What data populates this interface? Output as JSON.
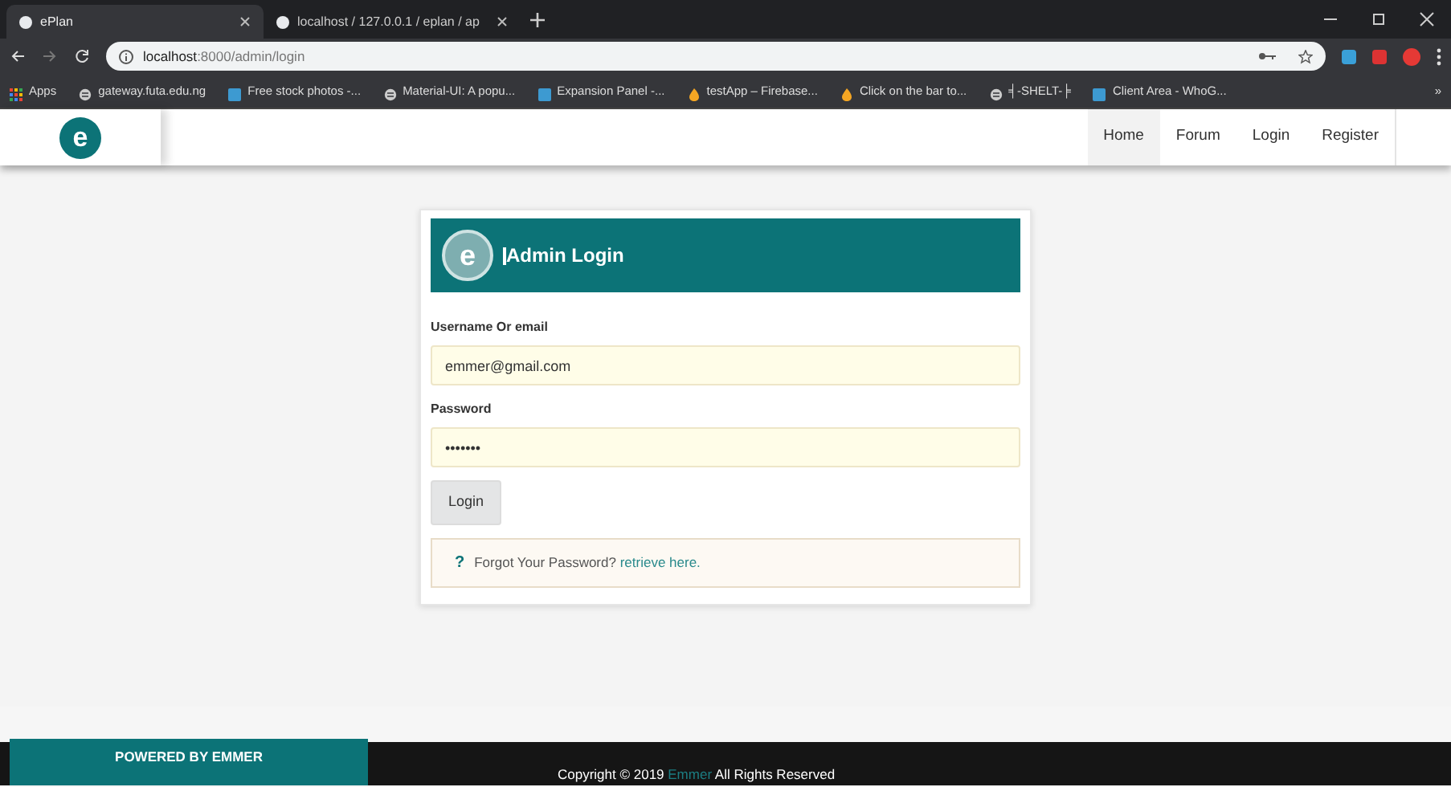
{
  "browser": {
    "tabs": [
      {
        "title": "ePlan",
        "selected": true
      },
      {
        "title": "localhost / 127.0.0.1 / eplan / ap",
        "selected": false
      }
    ],
    "address_bar": {
      "host": "localhost",
      "path": ":8000/admin/login"
    },
    "bookmarks": [
      {
        "label": "Apps"
      },
      {
        "label": "gateway.futa.edu.ng"
      },
      {
        "label": "Free stock photos -..."
      },
      {
        "label": "Material-UI: A popu..."
      },
      {
        "label": "Expansion Panel -..."
      },
      {
        "label": "testApp – Firebase..."
      },
      {
        "label": "Click on the bar to..."
      },
      {
        "label": "╡-SHELT-╞"
      },
      {
        "label": "Client Area - WhoG..."
      }
    ],
    "overflow": "»"
  },
  "navbar": {
    "links": [
      {
        "label": "Home",
        "selected": true
      },
      {
        "label": "Forum",
        "selected": false
      },
      {
        "label": "Login",
        "selected": false
      },
      {
        "label": "Register",
        "selected": false
      }
    ],
    "logo": "e"
  },
  "login_card": {
    "logo": "e",
    "title": "Admin Login",
    "fields": [
      {
        "label": "Username Or email",
        "value": "emmer@gmail.com"
      },
      {
        "label": "Password",
        "value": "•••••••"
      }
    ],
    "button": "Login",
    "help": {
      "icon": "?",
      "text": "Forgot Your Password?",
      "link": "retrieve here."
    }
  },
  "footer": {
    "powered_by": "POWERED BY EMMER",
    "copyright": "Copyright © 2019",
    "brand": "Emmer",
    "rights": "All Rights Reserved"
  }
}
